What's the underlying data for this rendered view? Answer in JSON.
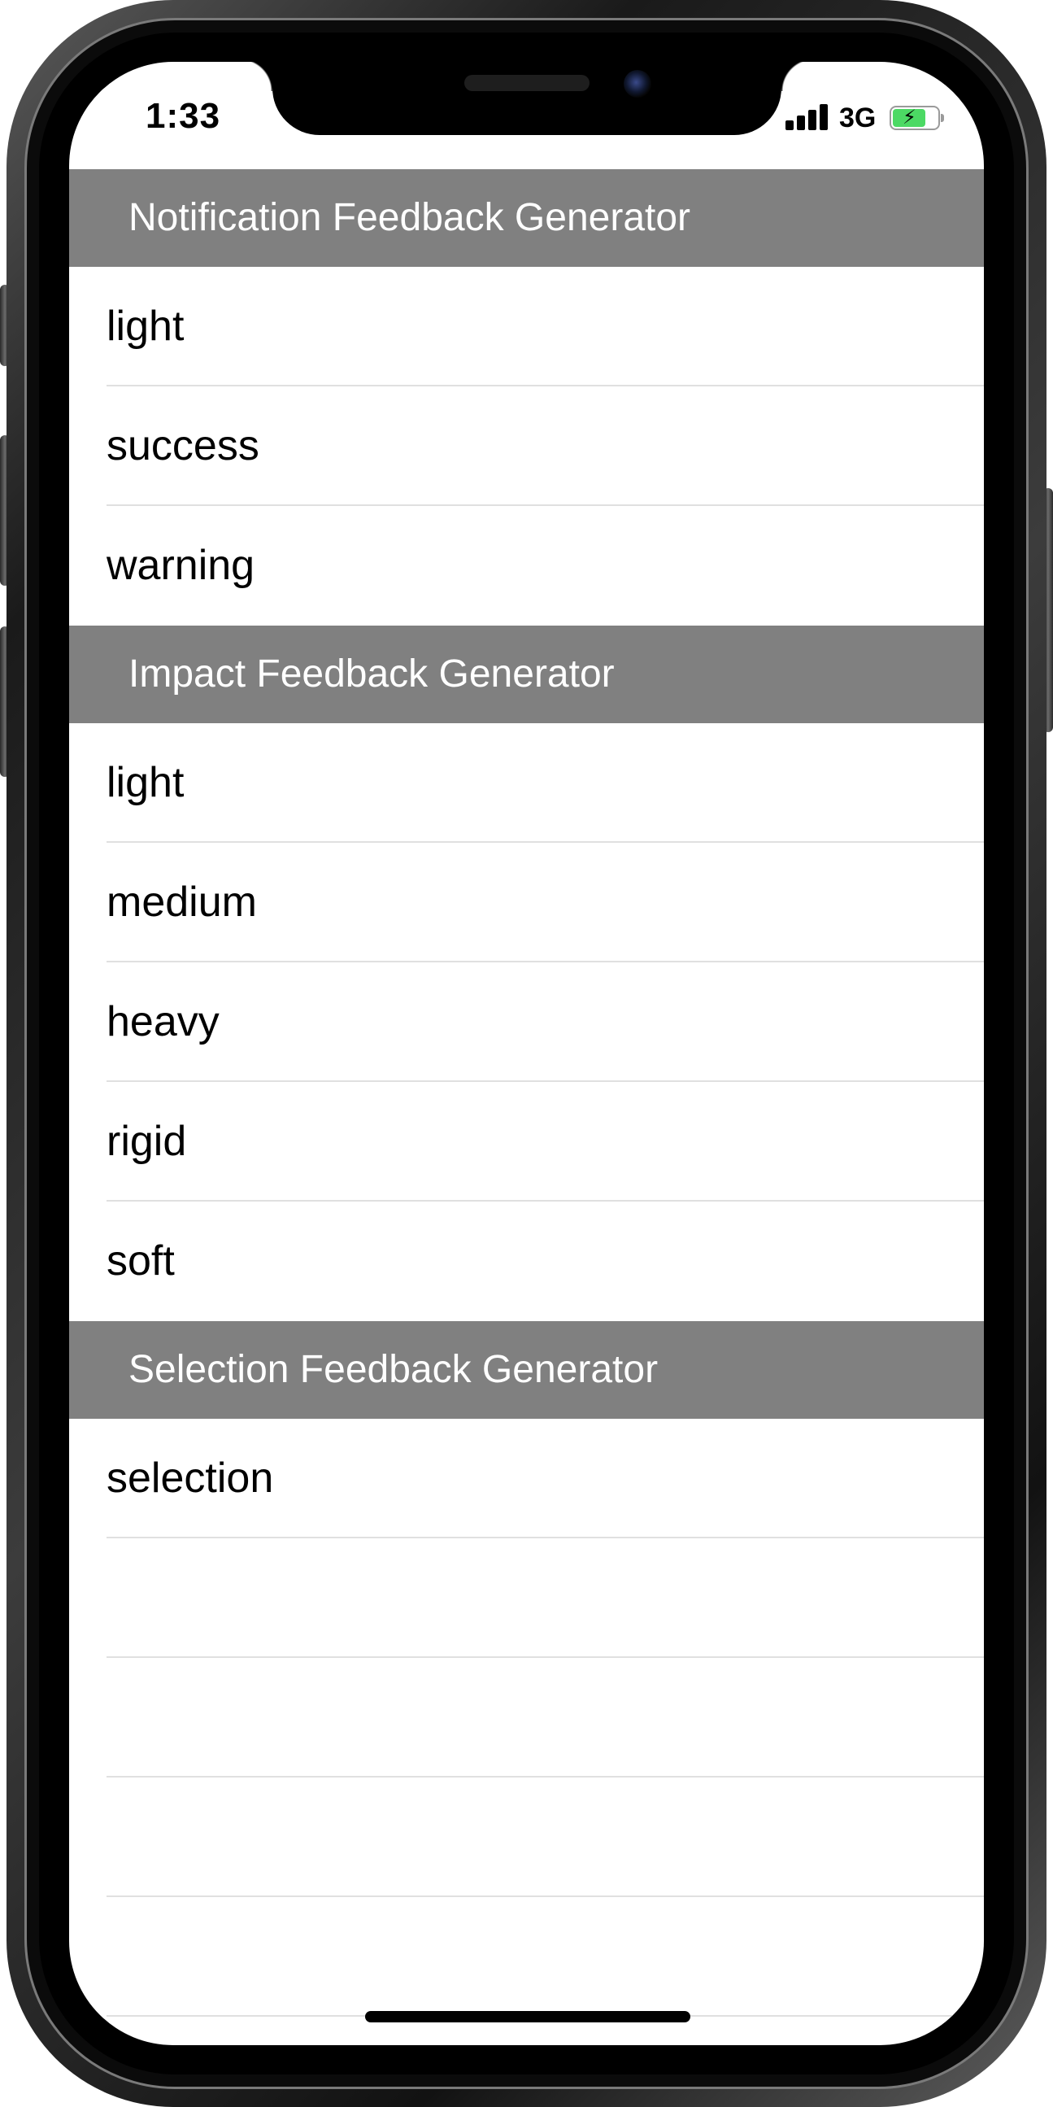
{
  "status_bar": {
    "time": "1:33",
    "network": "3G",
    "signal_bars": 4,
    "battery_level": 0.8,
    "battery_charging": true,
    "battery_color": "#4cd964"
  },
  "colors": {
    "section_header_bg": "#808080",
    "section_header_text": "#ffffff",
    "row_text": "#000000",
    "separator": "#e0e0e0"
  },
  "sections": [
    {
      "title": "Notification Feedback Generator",
      "items": [
        "light",
        "success",
        "warning"
      ]
    },
    {
      "title": "Impact Feedback Generator",
      "items": [
        "light",
        "medium",
        "heavy",
        "rigid",
        "soft"
      ]
    },
    {
      "title": "Selection Feedback Generator",
      "items": [
        "selection",
        "",
        "",
        "",
        ""
      ]
    }
  ]
}
